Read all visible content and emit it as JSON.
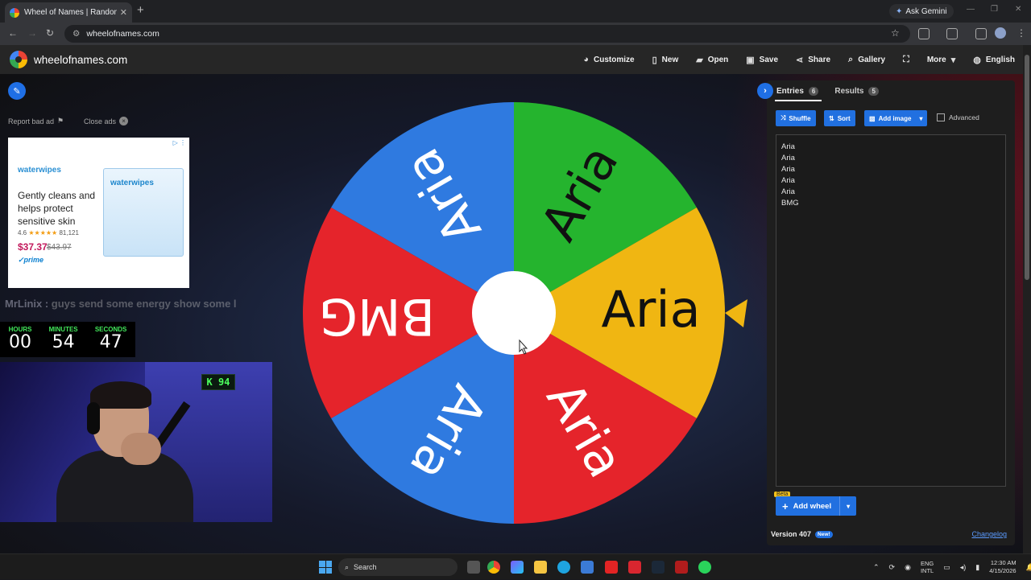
{
  "browser": {
    "tab_title": "Wheel of Names | Random nam",
    "address": "wheelofnames.com",
    "gemini_label": "Ask Gemini"
  },
  "site": {
    "name": "wheelofnames.com",
    "menu": [
      {
        "label": "Customize",
        "icon": "palette-icon"
      },
      {
        "label": "New",
        "icon": "file-icon"
      },
      {
        "label": "Open",
        "icon": "folder-icon"
      },
      {
        "label": "Save",
        "icon": "save-icon"
      },
      {
        "label": "Share",
        "icon": "share-icon"
      },
      {
        "label": "Gallery",
        "icon": "search-icon"
      },
      {
        "label": "",
        "icon": "fullscreen-icon"
      },
      {
        "label": "More",
        "icon": "chevron-down-icon"
      },
      {
        "label": "English",
        "icon": "globe-icon"
      }
    ]
  },
  "ads": {
    "report": "Report bad ad",
    "close": "Close ads",
    "brand": "waterwipes",
    "copy": "Gently cleans and helps protect sensitive skin",
    "rating": "4.6",
    "reviews": "81,121",
    "price": "$37.37",
    "old_price": "$43.97",
    "prime": "prime"
  },
  "overlay": {
    "chat_user": "MrLinix :",
    "chat_text": "guys send some energy show some l"
  },
  "timer": {
    "hours_label": "HOURS",
    "hours": "00",
    "minutes_label": "MINUTES",
    "minutes": "54",
    "seconds_label": "SECONDS",
    "seconds": "47"
  },
  "webcam": {
    "neon_sign": "K 94"
  },
  "wheel": {
    "segments": [
      {
        "label": "Aria",
        "color": "#2f7ae0"
      },
      {
        "label": "Aria",
        "color": "#25b42e"
      },
      {
        "label": "Aria",
        "color": "#f0b612"
      },
      {
        "label": "Aria",
        "color": "#e5242b"
      },
      {
        "label": "Aria",
        "color": "#2f7ae0"
      },
      {
        "label": "BMG",
        "color": "#e5242b"
      }
    ],
    "pointer_color": "#f0b612"
  },
  "panel": {
    "entries_tab": "Entries",
    "entries_count": "6",
    "results_tab": "Results",
    "results_count": "5",
    "shuffle": "Shuffle",
    "sort": "Sort",
    "add_image": "Add image",
    "advanced": "Advanced",
    "entries": [
      "Aria",
      "Aria",
      "Aria",
      "Aria",
      "Aria",
      "BMG"
    ],
    "beta": "Beta",
    "add_wheel": "Add wheel",
    "version": "Version 407",
    "new_badge": "New!",
    "changelog": "Changelog"
  },
  "taskbar": {
    "search": "Search",
    "lang_top": "ENG",
    "lang_bottom": "INTL",
    "time": "12:30 AM",
    "date": "4/15/2026"
  }
}
